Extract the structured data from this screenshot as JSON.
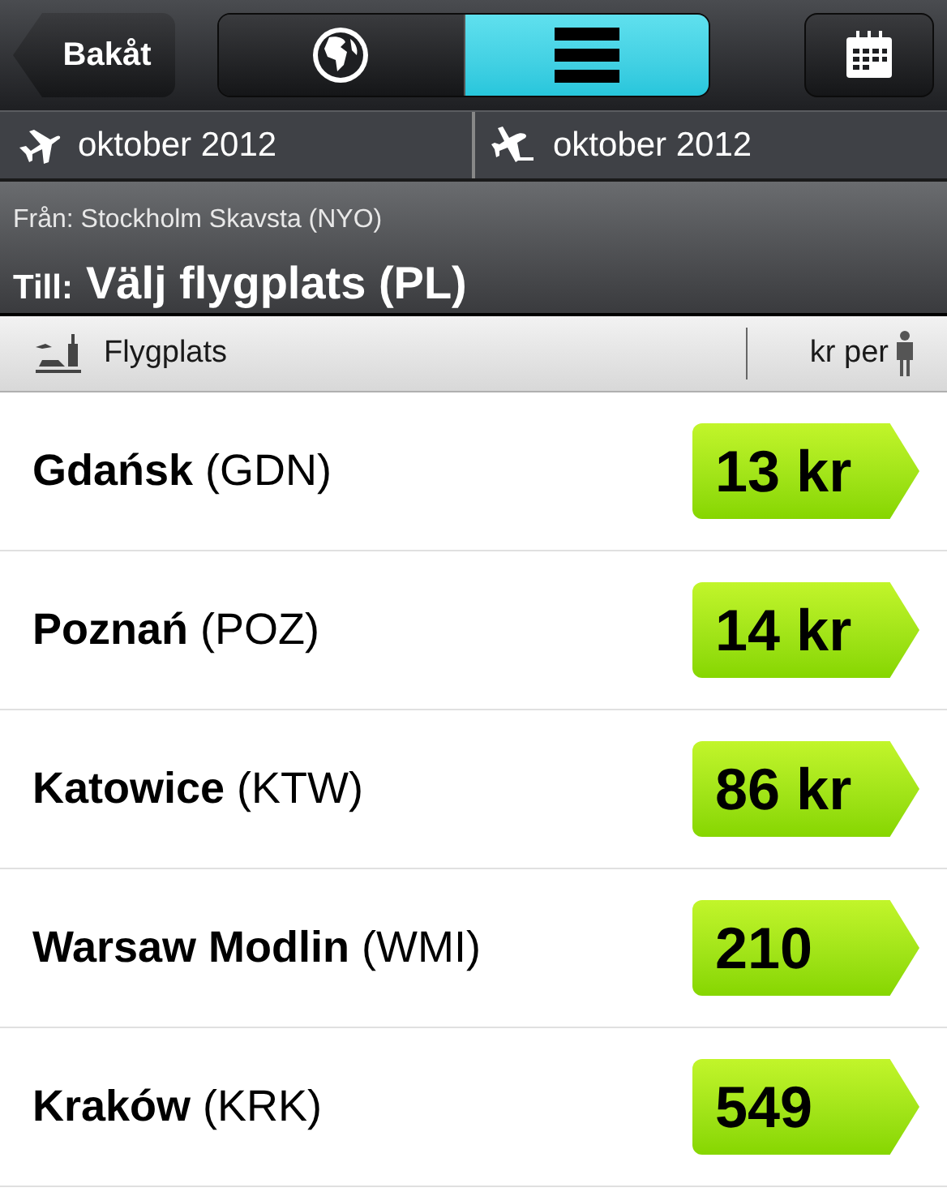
{
  "nav": {
    "back": "Bakåt",
    "segments": [
      {
        "kind": "globe",
        "selected": false
      },
      {
        "kind": "list",
        "selected": true
      }
    ]
  },
  "dates": [
    "oktober 2012",
    "oktober 2012"
  ],
  "route": {
    "from_label": "Från:",
    "from": "Stockholm Skavsta (NYO)",
    "to_label": "Till:",
    "to": "Välj flygplats (PL)"
  },
  "columns": {
    "airport": "Flygplats",
    "price": "kr per"
  },
  "rows": [
    {
      "name": "Gdańsk",
      "code": "(GDN)",
      "price": "13 kr"
    },
    {
      "name": "Poznań",
      "code": "(POZ)",
      "price": "14 kr"
    },
    {
      "name": "Katowice",
      "code": "(KTW)",
      "price": "86 kr"
    },
    {
      "name": "Warsaw Modlin",
      "code": "(WMI)",
      "price": "210"
    },
    {
      "name": "Kraków",
      "code": "(KRK)",
      "price": "549"
    }
  ]
}
